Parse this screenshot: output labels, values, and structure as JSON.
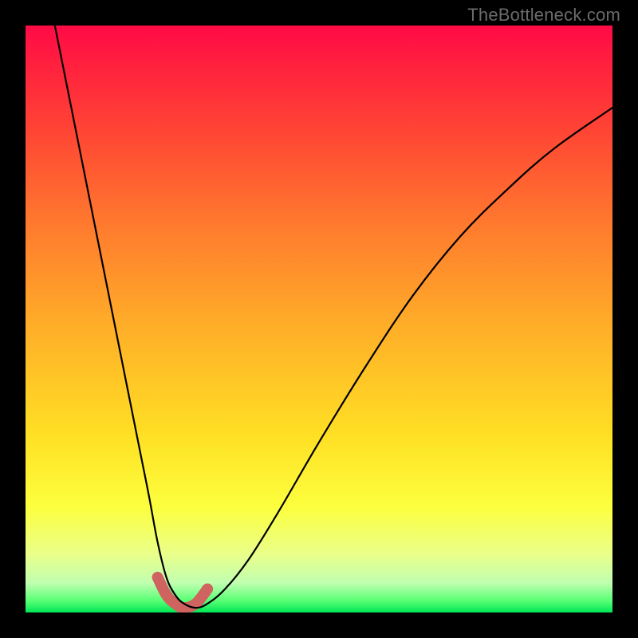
{
  "watermark": "TheBottleneck.com",
  "chart_data": {
    "type": "line",
    "title": "",
    "xlabel": "",
    "ylabel": "",
    "xlim": [
      0,
      100
    ],
    "ylim": [
      0,
      100
    ],
    "series": [
      {
        "name": "bottleneck-curve",
        "x": [
          5,
          7,
          9,
          11,
          13,
          15,
          17,
          19,
          21,
          22.5,
          24,
          25.5,
          27,
          29,
          31,
          34,
          38,
          43,
          50,
          58,
          66,
          74,
          82,
          90,
          100
        ],
        "values": [
          100,
          90,
          80,
          70,
          60,
          50,
          40,
          30,
          20,
          12,
          6,
          3,
          1.5,
          0.8,
          1.5,
          4,
          9,
          17,
          29,
          42,
          54,
          64,
          72,
          79,
          86
        ]
      }
    ],
    "highlight": {
      "name": "valley-highlight",
      "x": [
        22.5,
        24,
        25.5,
        27,
        29,
        31
      ],
      "values": [
        6,
        3,
        1.5,
        0.8,
        1.5,
        4
      ],
      "color": "#cf6360"
    },
    "colors": {
      "curve": "#000000",
      "highlight": "#cf6360",
      "gradient_top": "#ff0a46",
      "gradient_bottom": "#00e756"
    }
  }
}
